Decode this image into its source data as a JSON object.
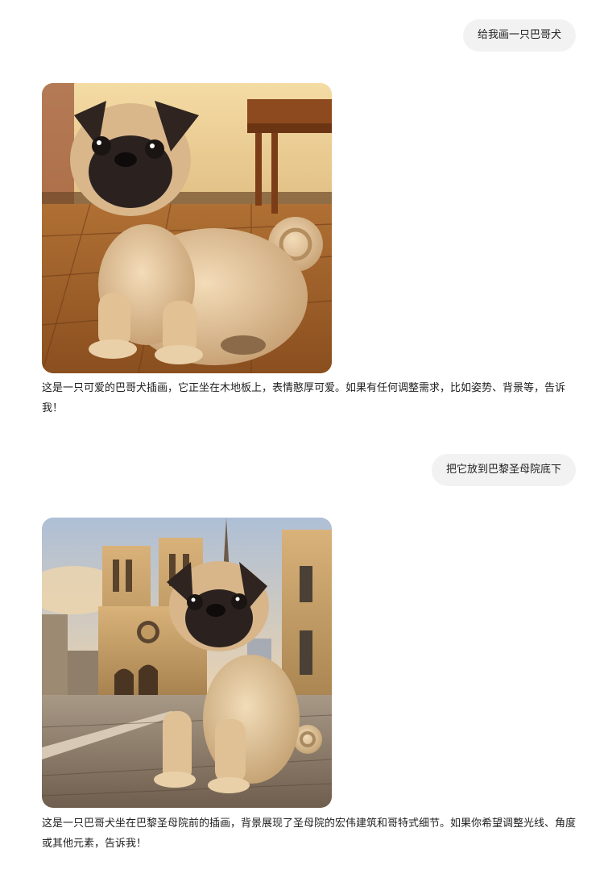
{
  "messages": [
    {
      "role": "user",
      "text": "给我画一只巴哥犬"
    },
    {
      "role": "assistant",
      "image": "pug-illustration-wooden-floor",
      "text": "这是一只可爱的巴哥犬插画，它正坐在木地板上，表情憨厚可爱。如果有任何调整需求，比如姿势、背景等，告诉我！"
    },
    {
      "role": "user",
      "text": "把它放到巴黎圣母院底下"
    },
    {
      "role": "assistant",
      "image": "pug-illustration-notre-dame",
      "text": "这是一只巴哥犬坐在巴黎圣母院前的插画，背景展现了圣母院的宏伟建筑和哥特式细节。如果你希望调整光线、角度或其他元素，告诉我！"
    }
  ]
}
